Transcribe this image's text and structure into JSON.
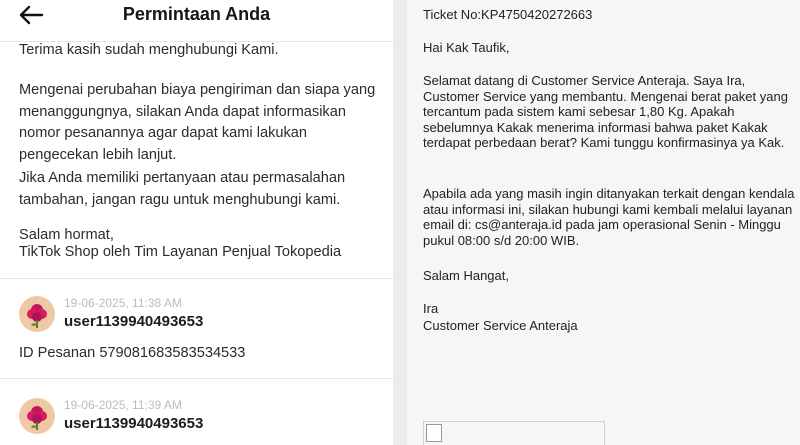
{
  "left_panel": {
    "title": "Permintaan Anda",
    "intro": "Terima kasih sudah menghubungi Kami.",
    "paragraph1": "Mengenai perubahan biaya pengiriman dan siapa yang menanggungnya, silakan Anda dapat informasikan nomor pesanannya agar dapat kami lakukan pengecekan lebih lanjut.",
    "paragraph2": "Jika Anda memiliki pertanyaan atau permasalahan tambahan, jangan ragu untuk menghubungi kami.",
    "closing": "Salam hormat,",
    "signature": "TikTok Shop oleh Tim Layanan Penjual Tokopedia",
    "messages": [
      {
        "timestamp": "19-06-2025, 11:38 AM",
        "username": "user1139940493653",
        "text": "ID Pesanan 579081683583534533"
      },
      {
        "timestamp": "19-06-2025, 11:39 AM",
        "username": "user1139940493653"
      }
    ]
  },
  "right_panel": {
    "ticket": "Ticket No:KP4750420272663",
    "greeting": "Hai Kak Taufik,",
    "body1": "Selamat datang di Customer Service Anteraja. Saya Ira, Customer Service yang membantu. Mengenai berat paket yang tercantum pada sistem kami sebesar 1,80 Kg. Apakah sebelumnya Kakak menerima informasi bahwa paket Kakak terdapat perbedaan berat? Kami tunggu konfirmasinya ya Kak.",
    "body2": "Apabila ada yang masih ingin ditanyakan terkait dengan kendala atau informasi ini,  silakan hubungi kami kembali melalui layanan email di: cs@anteraja.id pada jam operasional Senin - Minggu pukul 08:00 s/d 20:00 WIB.",
    "closing": "Salam Hangat,",
    "agent_name": "Ira",
    "agent_title": "Customer Service Anteraja"
  },
  "icons": {
    "back": "arrow-left-icon",
    "avatar": "flower-avatar-icon",
    "broken_image": "broken-image-icon"
  },
  "colors": {
    "avatar_bg": "#efc9a6",
    "avatar_flower": "#c2185b",
    "timestamp": "#bcbcbc"
  }
}
